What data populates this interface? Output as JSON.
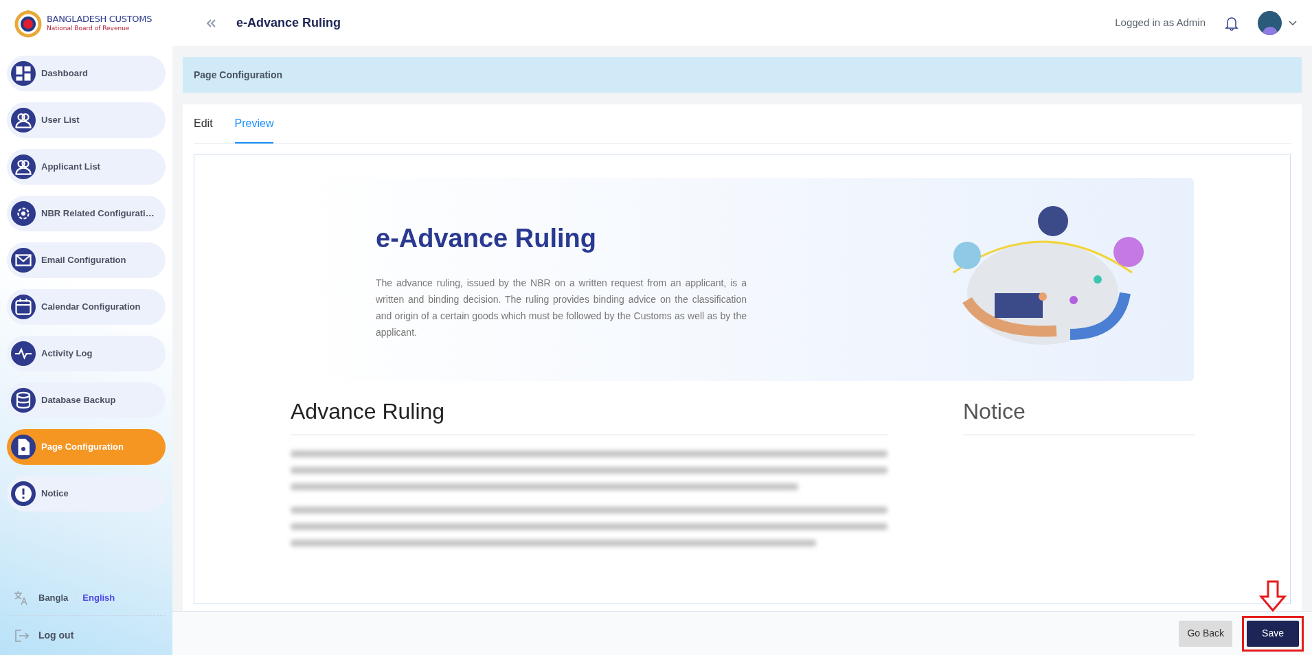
{
  "header": {
    "logo_title": "BANGLADESH CUSTOMS",
    "logo_subtitle": "National Board of Revenue",
    "page_title": "e-Advance Ruling",
    "user_label": "Logged in as Admin"
  },
  "sidebar": {
    "items": [
      {
        "label": "Dashboard",
        "selected": false
      },
      {
        "label": "User List",
        "selected": false
      },
      {
        "label": "Applicant List",
        "selected": false
      },
      {
        "label": "NBR Related Configurati…",
        "selected": false
      },
      {
        "label": "Email Configuration",
        "selected": false
      },
      {
        "label": "Calendar Configuration",
        "selected": false
      },
      {
        "label": "Activity Log",
        "selected": false
      },
      {
        "label": "Database Backup",
        "selected": false
      },
      {
        "label": "Page Configuration",
        "selected": true
      },
      {
        "label": "Notice",
        "selected": false
      }
    ],
    "languages": [
      {
        "label": "Bangla",
        "selected": false
      },
      {
        "label": "English",
        "selected": true
      }
    ],
    "logout": "Log out"
  },
  "section_bar": {
    "title": "Page Configuration"
  },
  "tabs": [
    {
      "label": "Edit",
      "selected": false
    },
    {
      "label": "Preview",
      "selected": true
    }
  ],
  "preview": {
    "hero": {
      "title": "e-Advance Ruling",
      "text": "The advance ruling, issued by the NBR on a written request from an applicant, is a written and binding decision. The ruling provides binding advice on the classification and origin of a certain goods which must be followed by the Customs as well as by the applicant."
    },
    "main_heading": "Advance Ruling",
    "side_heading": "Notice"
  },
  "buttons": [
    {
      "label": "Go Back",
      "kind": "secondary",
      "highlighted": false
    },
    {
      "label": "Save",
      "kind": "primary",
      "highlighted": true
    }
  ]
}
